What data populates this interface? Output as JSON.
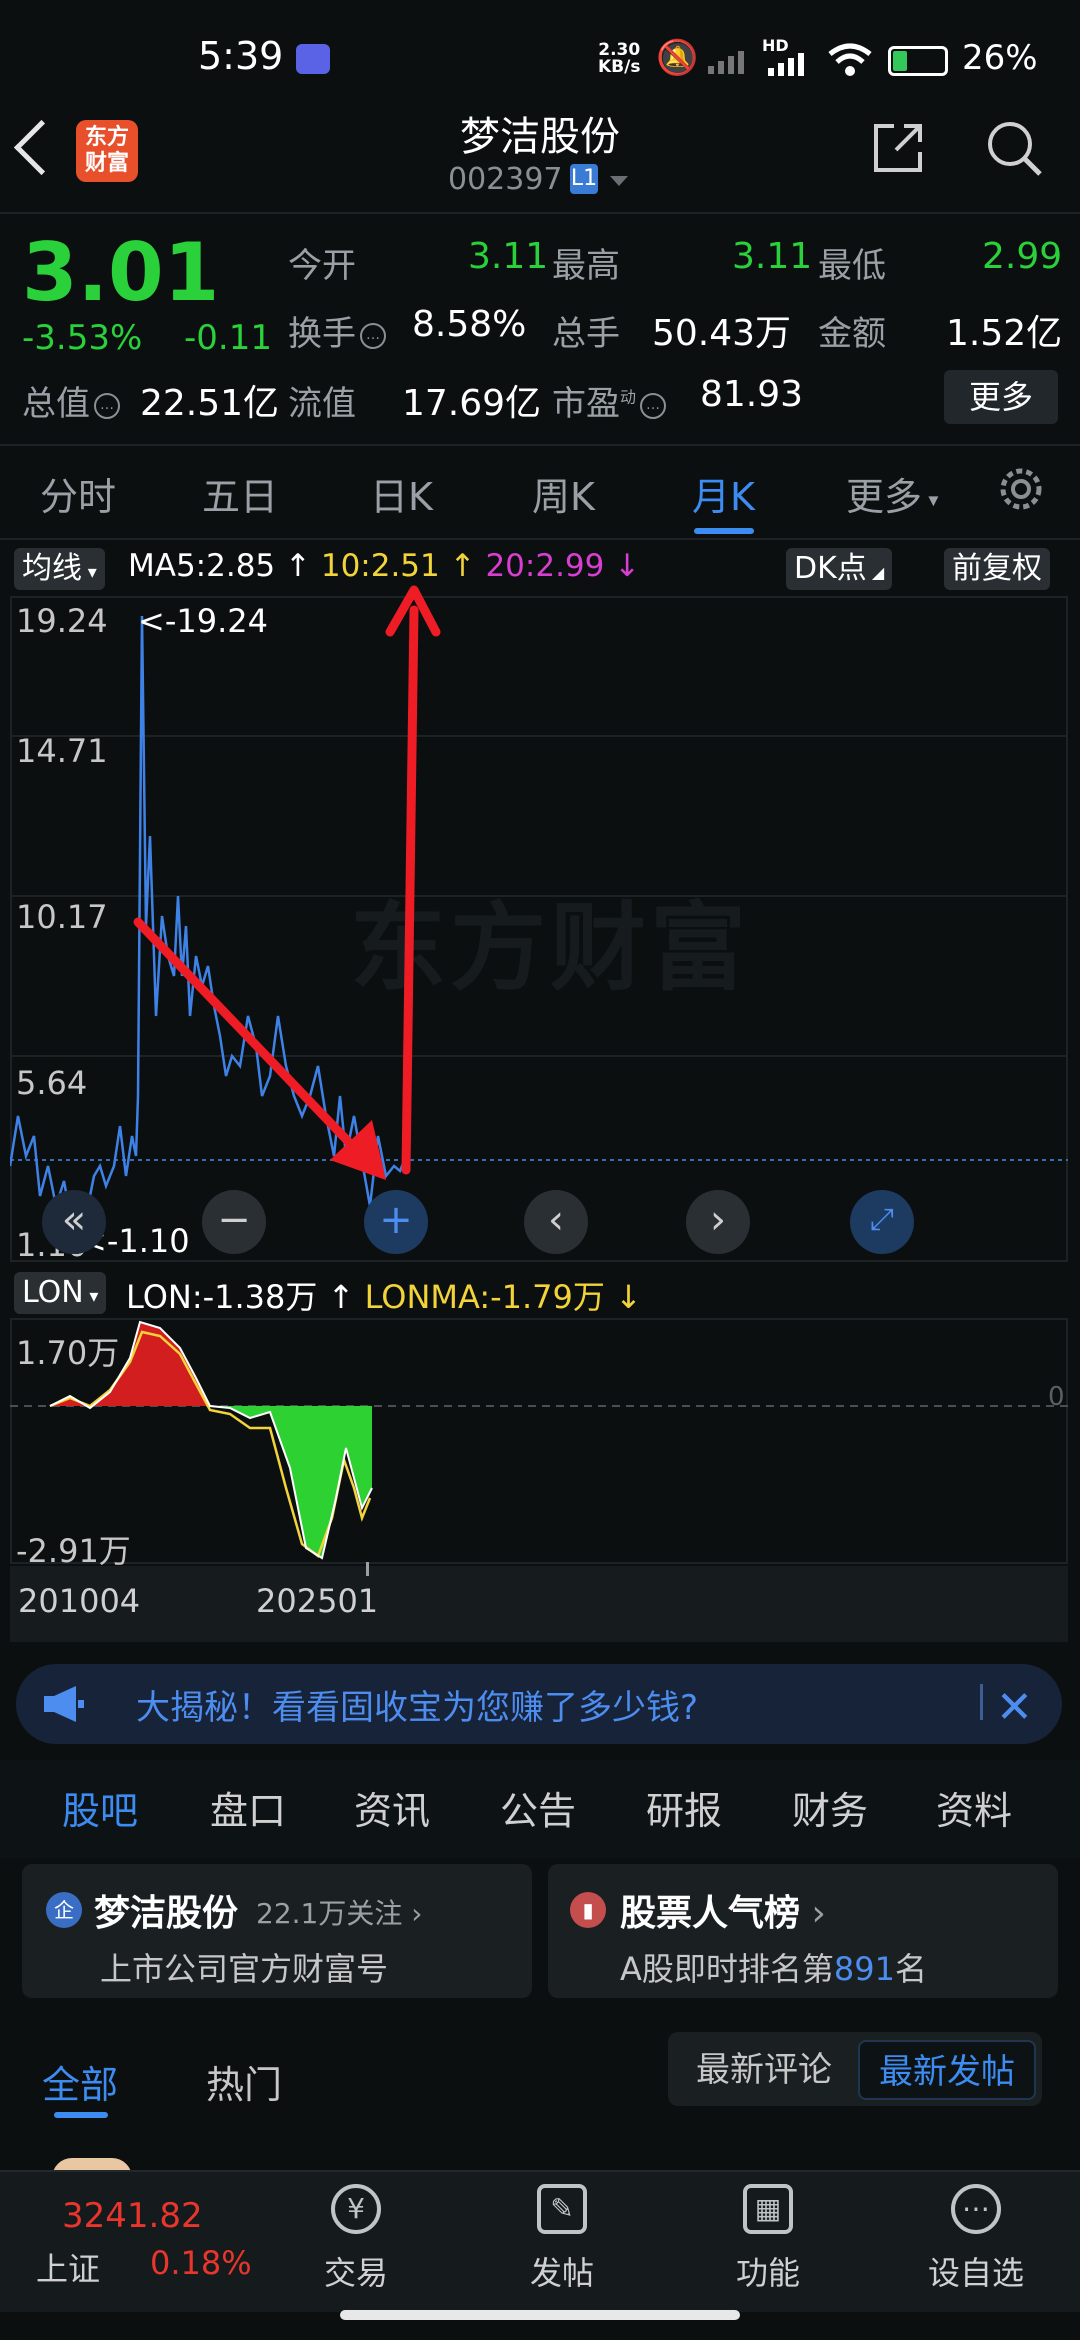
{
  "status_bar": {
    "time": "5:39",
    "speed_top": "2.30",
    "speed_bottom": "KB/s",
    "network": "HD",
    "battery": "26%"
  },
  "header": {
    "title": "梦洁股份",
    "code": "002397",
    "level_badge": "L1",
    "logo_line1": "东方",
    "logo_line2": "财富"
  },
  "quote": {
    "price": "3.01",
    "change_pct": "-3.53%",
    "change": "-0.11",
    "open_label": "今开",
    "open": "3.11",
    "high_label": "最高",
    "high": "3.11",
    "low_label": "最低",
    "low": "2.99",
    "turnover_label": "换手",
    "turnover": "8.58%",
    "volume_label": "总手",
    "volume": "50.43万",
    "amount_label": "金额",
    "amount": "1.52亿",
    "mktcap_label": "总值",
    "mktcap": "22.51亿",
    "float_label": "流值",
    "float": "17.69亿",
    "pe_label": "市盈",
    "pe_sup": "动",
    "pe": "81.93",
    "more_button": "更多"
  },
  "period_tabs": [
    "分时",
    "五日",
    "日K",
    "周K",
    "月K",
    "更多"
  ],
  "active_period": "月K",
  "chart": {
    "ma_select": "均线",
    "ma5": "MA5:2.85",
    "ma10": "10:2.51",
    "ma20": "20:2.99",
    "dk_button": "DK点",
    "fq_button": "前复权",
    "watermark": "东方财富",
    "y_ticks": [
      "19.24",
      "14.71",
      "10.17",
      "5.64",
      "1.10"
    ],
    "max_label": "<-19.24",
    "min_label": "<-1.10"
  },
  "lon": {
    "select": "LON",
    "lon_value": "LON:-1.38万",
    "lonma_value": "LONMA:-1.79万",
    "top": "1.70万",
    "bottom": "-2.91万",
    "zero": "0",
    "x_start": "201004",
    "x_mid": "202501"
  },
  "chart_data": {
    "type": "line",
    "title": "",
    "xlabel": "",
    "ylabel": "",
    "ylim": [
      1.1,
      19.24
    ],
    "x_range": [
      "201004",
      "202501"
    ],
    "series": [
      {
        "name": "MA5",
        "last": 2.85
      },
      {
        "name": "MA10",
        "last": 2.51
      },
      {
        "name": "MA20",
        "last": 2.99
      }
    ],
    "max": 19.24,
    "min": 1.1
  },
  "banner": {
    "text": "大揭秘！看看固收宝为您赚了多少钱?"
  },
  "sub_tabs": [
    "股吧",
    "盘口",
    "资讯",
    "公告",
    "研报",
    "财务",
    "资料"
  ],
  "cards": {
    "left_title": "梦洁股份",
    "left_follow": "22.1万关注",
    "left_sub": "上市公司官方财富号",
    "left_badge": "企",
    "right_title": "股票人气榜",
    "right_sub_prefix": "A股即时排名第",
    "right_rank": "891",
    "right_sub_suffix": "名"
  },
  "feed": {
    "tab_all": "全部",
    "tab_hot": "热门",
    "seg_latest_comment": "最新评论",
    "seg_latest_post": "最新发帖"
  },
  "bottom_bar": {
    "index_value": "3241.82",
    "index_name": "上证",
    "index_change": "0.18%",
    "items": [
      "交易",
      "发帖",
      "功能",
      "设自选"
    ]
  }
}
